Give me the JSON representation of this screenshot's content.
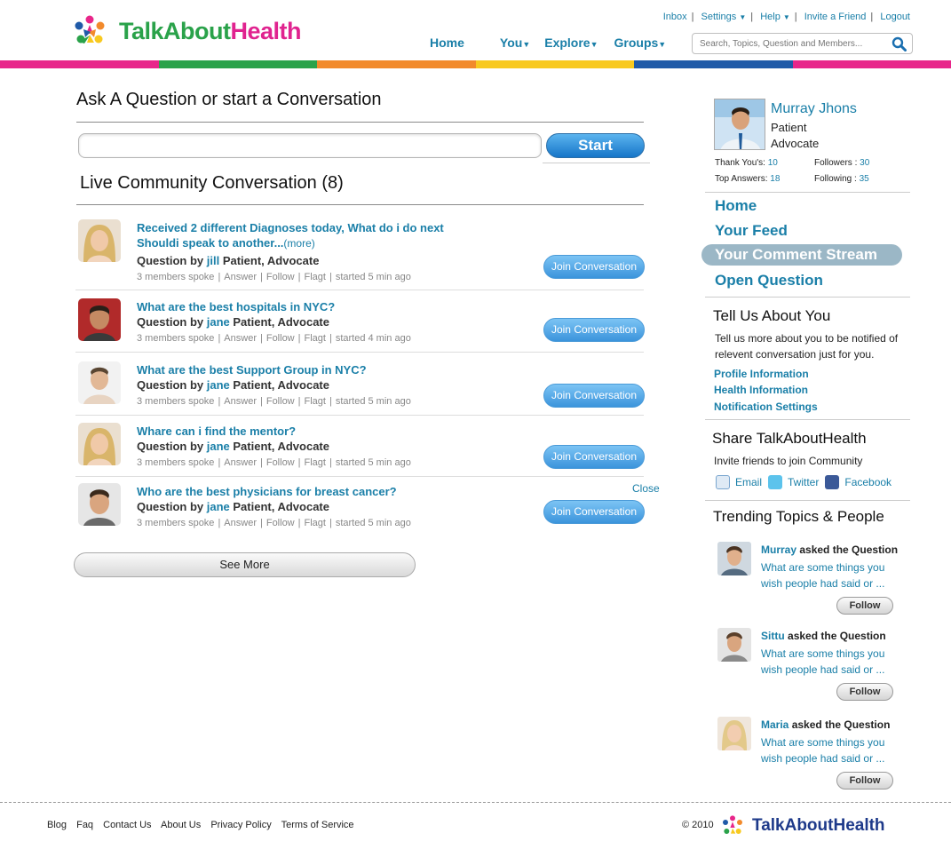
{
  "brand": {
    "name_part1": "TalkAbout",
    "name_part2": "Health",
    "footer_name": "TalkAboutHealth"
  },
  "top_links": [
    "Inbox",
    "Settings",
    "Help",
    "Invite a Friend",
    "Logout"
  ],
  "main_nav": [
    "Home",
    "You",
    "Explore",
    "Groups"
  ],
  "search": {
    "placeholder": "Search, Topics, Question and Members..."
  },
  "color_bar": [
    "#e8268a",
    "#2aa24a",
    "#f28a2b",
    "#f8c91f",
    "#1f5aa8",
    "#e8268a"
  ],
  "ask": {
    "title": "Ask A Question or start a Conversation",
    "input_value": "",
    "start_label": "Start"
  },
  "live": {
    "title": "Live Community Conversation (8)",
    "conversations": [
      {
        "question_l1": "Received 2 different Diagnoses today, What do i do next",
        "question_l2": "Shouldi speak to another...",
        "more": "(more)",
        "by_prefix": "Question by",
        "author": "jill",
        "roles": "Patient, Advocate",
        "members": "3 members spoke",
        "answer": "Answer",
        "follow": "Follow",
        "flag": "Flagt",
        "started": "started 5 min ago",
        "join": "Join Conversation"
      },
      {
        "question_l1": "What are the best hospitals in NYC?",
        "by_prefix": "Question by",
        "author": "jane",
        "roles": "Patient, Advocate",
        "members": "3 members spoke",
        "answer": "Answer",
        "follow": "Follow",
        "flag": "Flagt",
        "started": "started 4 min ago",
        "join": "Join Conversation"
      },
      {
        "question_l1": "What are the best Support Group in NYC?",
        "by_prefix": "Question by",
        "author": "jane",
        "roles": "Patient, Advocate",
        "members": "3 members spoke",
        "answer": "Answer",
        "follow": "Follow",
        "flag": "Flagt",
        "started": "started 5 min ago",
        "join": "Join Conversation"
      },
      {
        "question_l1": "Whare can i find the mentor?",
        "by_prefix": "Question by",
        "author": "jane",
        "roles": "Patient, Advocate",
        "members": "3 members spoke",
        "answer": "Answer",
        "follow": "Follow",
        "flag": "Flagt",
        "started": "started 5 min ago",
        "join": "Join Conversation"
      },
      {
        "question_l1": "Who are the best physicians for breast cancer?",
        "by_prefix": "Question by",
        "author": "jane",
        "roles": "Patient, Advocate",
        "members": "3 members spoke",
        "answer": "Answer",
        "follow": "Follow",
        "flag": "Flagt",
        "started": "started 5 min ago",
        "join": "Join Conversation"
      }
    ],
    "close_label": "Close",
    "see_more": "See More"
  },
  "profile": {
    "name": "Murray Jhons",
    "role1": "Patient",
    "role2": "Advocate",
    "thank_label": "Thank You's:",
    "thank_value": "10",
    "followers_label": "Followers :",
    "followers_value": "30",
    "answers_label": "Top Answers:",
    "answers_value": "18",
    "following_label": "Following :",
    "following_value": "35"
  },
  "right_nav": [
    "Home",
    "Your Feed",
    "Your Comment Stream",
    "Open Question"
  ],
  "about": {
    "title": "Tell Us About You",
    "text_l1": "Tell us more about you to be notified of",
    "text_l2": "relevent conversation just for you.",
    "links": [
      "Profile Information",
      "Health Information",
      "Notification Settings"
    ]
  },
  "share": {
    "title": "Share TalkAboutHealth",
    "text": "Invite friends to join Community",
    "email": "Email",
    "twitter": "Twitter",
    "facebook": "Facebook"
  },
  "trending": {
    "title": "Trending Topics & People",
    "items": [
      {
        "name": "Murray",
        "action": "asked the Question",
        "q1": "What are some things you",
        "q2": "wish people had said or ...",
        "follow": "Follow"
      },
      {
        "name": "Sittu",
        "action": "asked the Question",
        "q1": "What are some things you",
        "q2": "wish people had said or ...",
        "follow": "Follow"
      },
      {
        "name": "Maria",
        "action": "asked the Question",
        "q1": "What are some things you",
        "q2": "wish people had said or ...",
        "follow": "Follow"
      }
    ]
  },
  "footer": {
    "links": [
      "Blog",
      "Faq",
      "Contact Us",
      "About Us",
      "Privacy Policy",
      "Terms of Service"
    ],
    "copyright": "© 2010"
  }
}
